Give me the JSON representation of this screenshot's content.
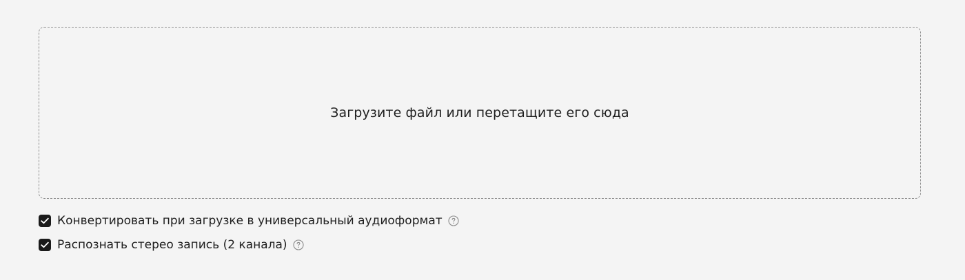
{
  "upload": {
    "prompt": "Загрузите файл или перетащите его сюда"
  },
  "options": [
    {
      "label": "Конвертировать при загрузке в универсальный аудиоформат",
      "checked": true,
      "icon": "help-circle-icon"
    },
    {
      "label": "Распознать стерео запись (2 канала)",
      "checked": true,
      "icon": "help-circle-icon"
    }
  ],
  "colors": {
    "background": "#f4f4f4",
    "checkbox": "#1a1a1a",
    "border": "#8f8f8f",
    "help_icon": "#8a8a8a"
  }
}
